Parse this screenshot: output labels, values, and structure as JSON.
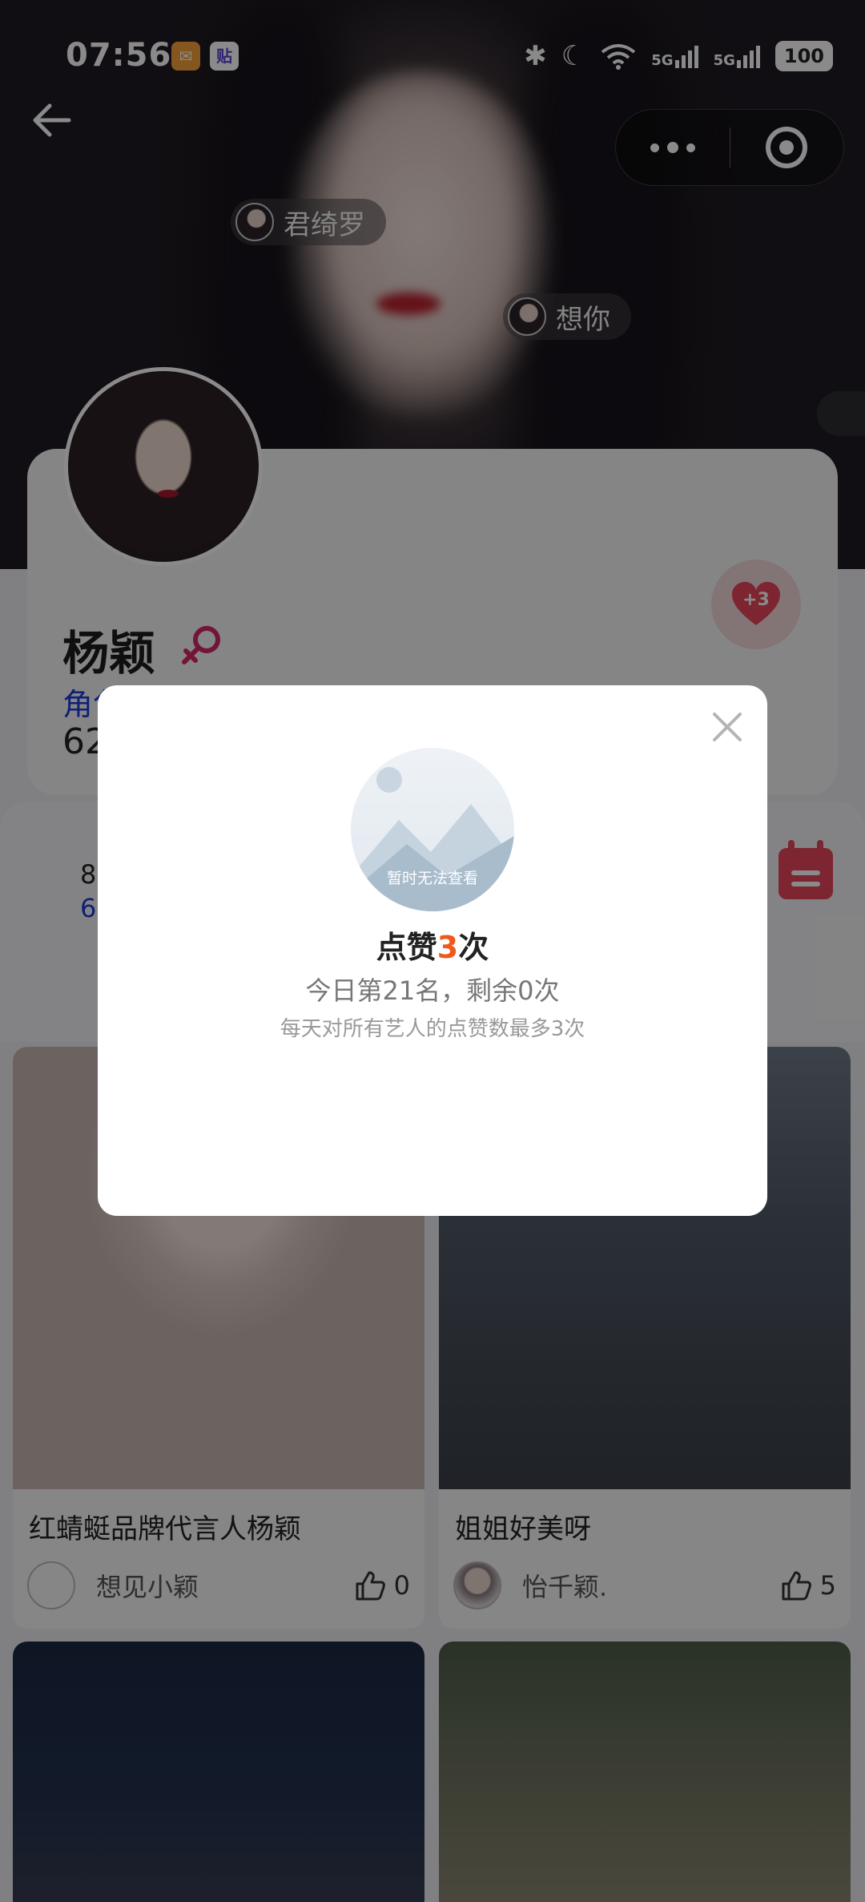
{
  "status_bar": {
    "time": "07:56",
    "app_badge_2": "贴",
    "signal_1": "5G",
    "signal_2": "5G",
    "battery": "100"
  },
  "danmu": [
    {
      "text": "君绮罗"
    },
    {
      "text": "想你"
    }
  ],
  "profile": {
    "name": "杨颖",
    "role_partial": "角色",
    "count_partial": "62"
  },
  "like_button": {
    "label": "+3"
  },
  "rank": {
    "line1_partial": "8",
    "line2_partial": "6"
  },
  "modal": {
    "image_placeholder": "暂时无法查看",
    "title_prefix": "点赞",
    "title_number": "3",
    "title_suffix": "次",
    "subtitle": "今日第21名，剩余0次",
    "note": "每天对所有艺人的点赞数最多3次"
  },
  "posts": [
    {
      "title": "红蜻蜓品牌代言人杨颖",
      "author": "想见小颖",
      "likes": "0"
    },
    {
      "title": "姐姐好美呀",
      "author": "怡千颖.",
      "likes": "5"
    }
  ],
  "colors": {
    "accent_orange": "#f0591c",
    "like_red": "#e8455a",
    "link_blue": "#1a3adb"
  }
}
